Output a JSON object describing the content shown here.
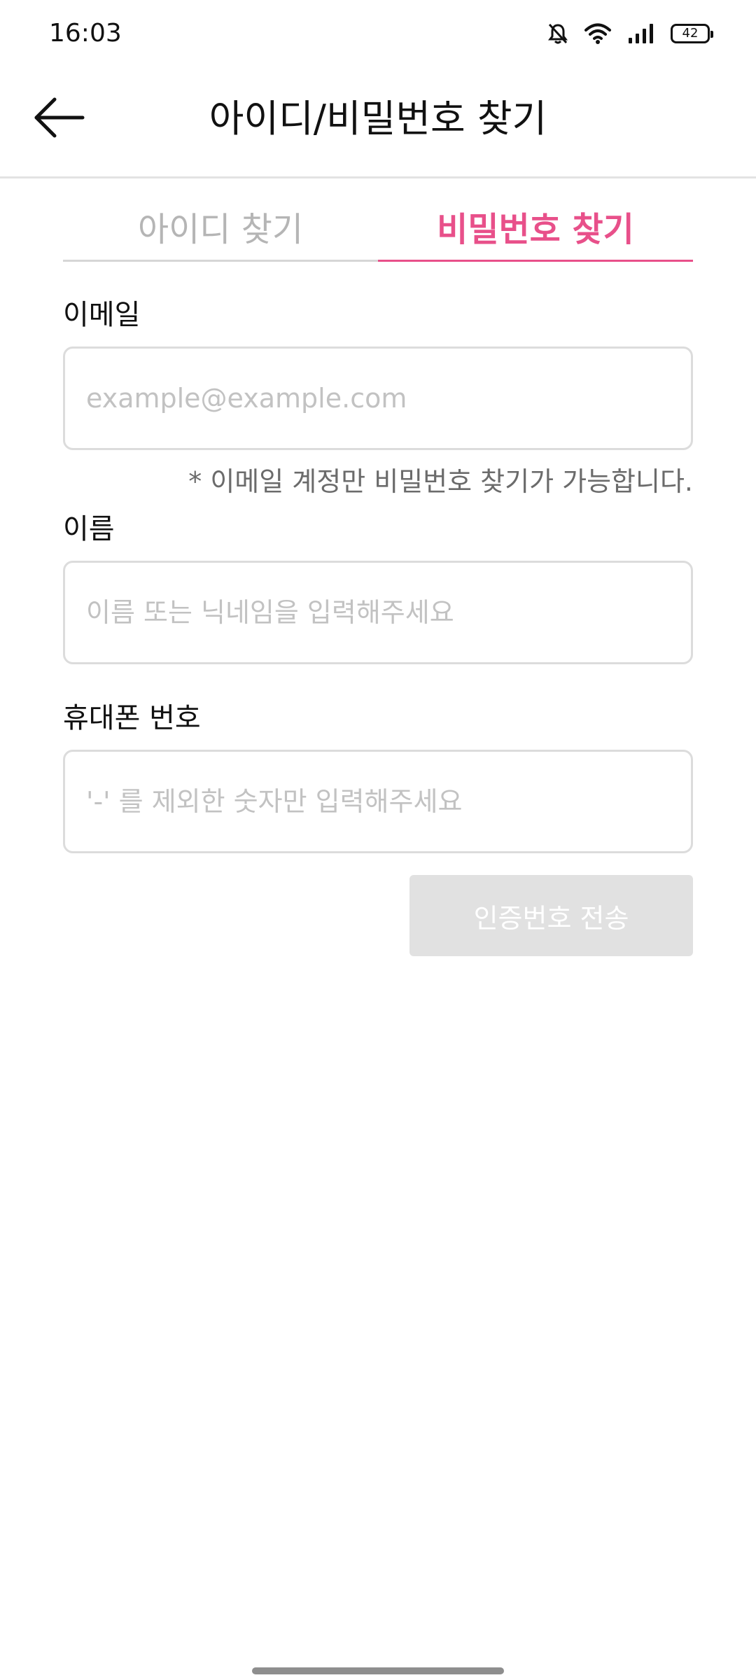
{
  "status_bar": {
    "time": "16:03",
    "battery_level": "42",
    "icons": [
      "bell-off-icon",
      "wifi-icon",
      "signal-icon",
      "battery-icon"
    ]
  },
  "header": {
    "title": "아이디/비밀번호 찾기",
    "back_icon": "arrow-left-icon"
  },
  "tabs": [
    {
      "label": "아이디 찾기",
      "active": false
    },
    {
      "label": "비밀번호 찾기",
      "active": true
    }
  ],
  "form": {
    "email": {
      "label": "이메일",
      "placeholder": "example@example.com",
      "value": ""
    },
    "email_note": "* 이메일 계정만 비밀번호 찾기가 가능합니다.",
    "name": {
      "label": "이름",
      "placeholder": "이름 또는 닉네임을 입력해주세요",
      "value": ""
    },
    "phone": {
      "label": "휴대폰 번호",
      "placeholder": "'-' 를 제외한 숫자만 입력해주세요",
      "value": ""
    },
    "send_button_label": "인증번호 전송",
    "send_button_enabled": false
  },
  "colors": {
    "accent": "#e8508a",
    "inactive_tab": "#b5b5b5",
    "disabled_button": "#e1e1e1",
    "placeholder": "#c2c2c2"
  }
}
